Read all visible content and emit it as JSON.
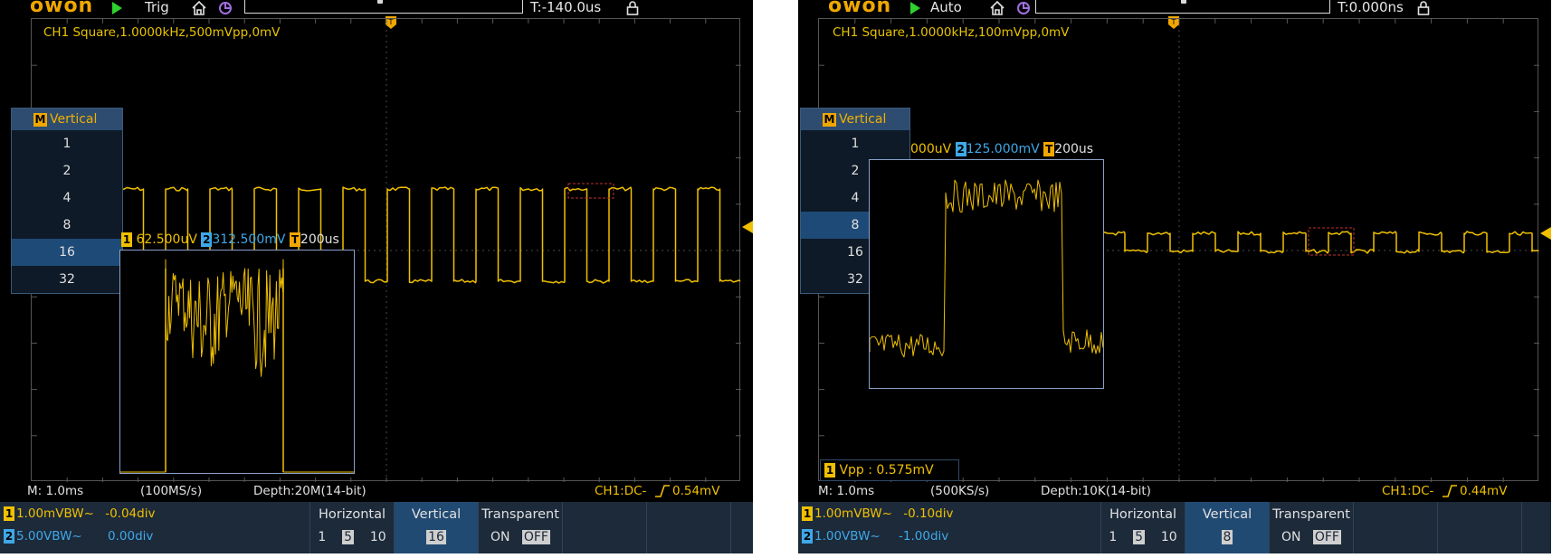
{
  "left": {
    "logo": "owon",
    "trigger_mode": "Trig",
    "time_position": "T:-140.0us",
    "channel_info": "CH1 Square,1.0000kHz,500mVpp,0mV",
    "vertical_menu": {
      "title": "Vertical",
      "badge": "M",
      "items": [
        "1",
        "2",
        "4",
        "8",
        "16",
        "32"
      ],
      "selected": "16"
    },
    "zoom_header": {
      "ch1": "62.500uV",
      "ch2": "312.500mV",
      "time": "200us",
      "b1": "1",
      "b2": "2",
      "bt": "T"
    },
    "status": {
      "timebase": "M: 1.0ms",
      "rate": "(100MS/s)",
      "depth": "Depth:20M(14-bit)",
      "trigger": "CH1:DC-",
      "trigger_level": "0.54mV"
    },
    "ch1": {
      "badge": "1",
      "scale": "1.00mV",
      "bw": "BW~",
      "offset": "-0.04div"
    },
    "ch2": {
      "badge": "2",
      "scale": "5.00V",
      "bw": "BW~",
      "offset": "0.00div"
    },
    "horizontal": {
      "label": "Horizontal",
      "options": [
        "1",
        "5",
        "10"
      ],
      "selected": "5"
    },
    "vertical": {
      "label": "Vertical",
      "value": "16"
    },
    "transparent": {
      "label": "Transparent",
      "on": "ON",
      "off": "OFF",
      "selected": "OFF"
    }
  },
  "right": {
    "logo": "owon",
    "trigger_mode": "Auto",
    "time_position": "T:0.000ns",
    "channel_info": "CH1 Square,1.0000kHz,100mVpp,0mV",
    "vertical_menu": {
      "title": "Vertical",
      "badge": "M",
      "items": [
        "1",
        "2",
        "4",
        "8",
        "16",
        "32"
      ],
      "selected": "8"
    },
    "zoom_header": {
      "ch1": "000uV",
      "ch2": "125.000mV",
      "time": "200us",
      "b2": "2",
      "bt": "T"
    },
    "measurement": {
      "badge": "1",
      "text": "Vpp : 0.575mV"
    },
    "status": {
      "timebase": "M: 1.0ms",
      "rate": "(500KS/s)",
      "depth": "Depth:10K(14-bit)",
      "trigger": "CH1:DC-",
      "trigger_level": "0.44mV"
    },
    "ch1": {
      "badge": "1",
      "scale": "1.00mV",
      "bw": "BW~",
      "offset": "-0.10div"
    },
    "ch2": {
      "badge": "2",
      "scale": "1.00V",
      "bw": "BW~",
      "offset": "-1.00div"
    },
    "horizontal": {
      "label": "Horizontal",
      "options": [
        "1",
        "5",
        "10"
      ],
      "selected": "5"
    },
    "vertical": {
      "label": "Vertical",
      "value": "8"
    },
    "transparent": {
      "label": "Transparent",
      "on": "ON",
      "off": "OFF",
      "selected": "OFF"
    }
  },
  "colors": {
    "ch1": "#f0c000",
    "ch2": "#3fa8e8",
    "panel": "#1c2a3a",
    "menu_selected": "#1e4a78"
  }
}
